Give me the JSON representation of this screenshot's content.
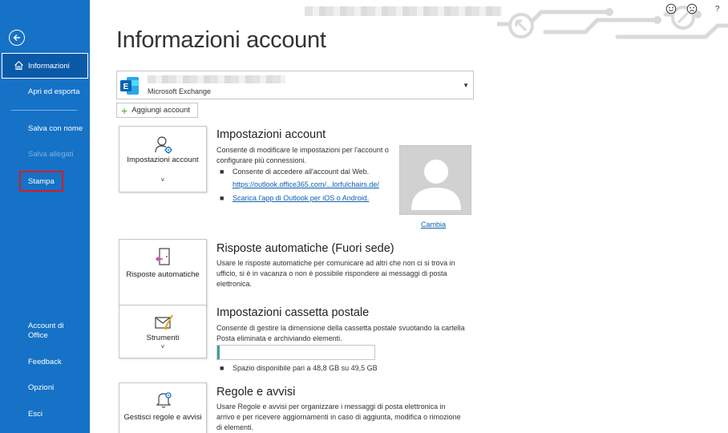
{
  "sidebar": {
    "items": [
      {
        "label": "Informazioni"
      },
      {
        "label": "Apri ed esporta"
      },
      {
        "label": "Salva con nome"
      },
      {
        "label": "Salva allegati"
      },
      {
        "label": "Stampa"
      },
      {
        "label": "Account di Office"
      },
      {
        "label": "Feedback"
      },
      {
        "label": "Opzioni"
      },
      {
        "label": "Esci"
      }
    ]
  },
  "header": {
    "title": "Informazioni account",
    "help_label": "?"
  },
  "account": {
    "type": "Microsoft Exchange",
    "add_label": "Aggiungi account"
  },
  "sections": {
    "account_settings": {
      "tile_label": "Impostazioni account",
      "title": "Impostazioni account",
      "text": "Consente di modificare le impostazioni per l'account o configurare più connessioni.",
      "bullet1": "Consente di accedere all'account dal Web.",
      "link1": "https://outlook.office365.com/...lorfulchairs.de/",
      "link2": "Scarica l'app di Outlook per iOS o Android.",
      "change_label": "Cambia"
    },
    "auto_replies": {
      "tile_label": "Risposte automatiche",
      "title": "Risposte automatiche (Fuori sede)",
      "text": "Usare le risposte automatiche per comunicare ad altri che non ci si trova in ufficio, si è in vacanza o non è possibile rispondere ai messaggi di posta elettronica."
    },
    "mailbox": {
      "tile_label": "Strumenti",
      "title": "Impostazioni cassetta postale",
      "text": "Consente di gestire la dimensione della cassetta postale svuotando la cartella Posta eliminata e archiviando elementi.",
      "usage_fraction": 0.015,
      "storage_text": "Spazio disponibile pari a 48,8 GB su 49,5 GB"
    },
    "rules": {
      "tile_label": "Gestisci regole e avvisi",
      "title": "Regole e avvisi",
      "text": "Usare Regole e avvisi per organizzare i messaggi di posta elettronica in arrivo e per ricevere aggiornamenti in caso di aggiunta, modifica o rimozione di elementi."
    }
  },
  "colors": {
    "sidebar_bg": "#1572c6",
    "accent": "#0d5fb3",
    "storage_fill": "#3aa0a6"
  }
}
